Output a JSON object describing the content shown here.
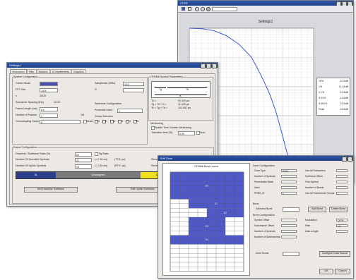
{
  "plot_window": {
    "title": "CCDF",
    "figure_title": "Settings1",
    "toolbar_icons": [
      "save-icon",
      "print-icon",
      "zoom-in-icon",
      "zoom-out-icon",
      "pan-icon"
    ],
    "zoom_field_value": "",
    "stats": [
      {
        "label": "10%",
        "value": "5.23dB"
      },
      {
        "label": "1%",
        "value": "11.61dB"
      },
      {
        "label": "0.1%",
        "value": "13.8dB"
      },
      {
        "label": "0.01%",
        "value": "14.8dB"
      },
      {
        "label": "0.001%",
        "value": "15.9dB"
      },
      {
        "label": "Peak",
        "value": "16.8dB"
      }
    ]
  },
  "chart_data": {
    "type": "line",
    "title": "Settings1",
    "xlabel": "",
    "ylabel": "",
    "xlim": [
      0,
      20
    ],
    "ylim": [
      1e-05,
      1
    ],
    "yscale": "log",
    "grid": true,
    "series": [
      {
        "x": [
          0,
          2,
          4,
          6,
          8,
          10,
          11,
          12,
          13,
          14,
          15,
          16,
          16.8
        ],
        "y": [
          1,
          0.96,
          0.82,
          0.55,
          0.28,
          0.1,
          0.04,
          0.015,
          0.005,
          0.0012,
          0.0002,
          3e-05,
          1e-05
        ]
      }
    ]
  },
  "settings_window": {
    "title": "Settings1",
    "tabs": [
      "Modulation",
      "Filter",
      "Markers",
      "IQ Impairments",
      "Graphics"
    ],
    "system_config": {
      "heading": "System Configuration",
      "carrier_mode_label": "Carrier Mode",
      "fft_size_label": "FFT Size",
      "fft_size_value": "1024",
      "samp_rate_label": "Samplerate (MHz)",
      "samp_rate_value": "10.0",
      "n_label": "n",
      "n_value": "28/25",
      "subcarrier_spacing_label": "Subcarrier Spacing (kHz)",
      "subcarrier_spacing_value": "10.94",
      "frame_length_label": "Frame Length (ms)",
      "frame_length_value": "5.0",
      "num_frames_label": "Number of Frames",
      "num_frames_value": "1",
      "oversampling_label": "Oversampling Factor",
      "oversampling_value": "8",
      "ratio_value": "1/8",
      "reduced_checkbox": "ldrate"
    },
    "subframe_config": {
      "heading": "Subframe Configuration",
      "preamble_label": "Preamble Index",
      "preamble_value": "0"
    },
    "group_selection": {
      "heading": "Group Selection",
      "items": [
        "0",
        "1",
        "2",
        "3",
        "4",
        "5"
      ]
    },
    "ofdma_params": {
      "heading": "OFDMA Symbol Parameters",
      "tg_label": "Tg",
      "tb_label": "Tb",
      "ts_label": "Ts",
      "tb_eq": "Tb =",
      "tb_val": "91.429 µs",
      "tg_eq": "Tg = Tb * G =",
      "tg_val": "11.429 µs",
      "ts_eq": "Ts = Tg + Tb =",
      "ts_val": "102.857 µs"
    },
    "windowing": {
      "heading": "Windowing",
      "enable_label": "Enable Time Domain Windowing",
      "transition_label": "Transition time (Ts)",
      "transition_value": "0.00",
      "auto_label": "Auto"
    },
    "frame_config": {
      "heading": "Frame Configuration",
      "dl_ratio_label": "Downlink / Subframe Ratio (%)",
      "dl_ratio_value": "50",
      "ttg_label": "Ttg Ratio",
      "dl_symbols_label": "Number Of Downlink Symbols",
      "dl_symbols_value": "21",
      "dl_symbols_calc": "(= 2.16 ms)",
      "dl_symbols_calc2": "(TTG: µs)",
      "ul_symbols_label": "Number Of Uplink Symbols",
      "ul_symbols_value": "18",
      "ul_symbols_calc": "(= 1.85 ms)",
      "ul_symbols_calc2": "(RTG: µs)",
      "remain_label": "Remain",
      "bar_labels": [
        "DL",
        "Unassigned",
        "UL"
      ],
      "edit_dl_button": "Edit Downlink Subframe",
      "edit_ul_button": "Edit Uplink Subframe"
    }
  },
  "edit_window": {
    "title": "Edit Zone",
    "grid_title": "OFDMA Burst Layout",
    "zone_config_heading": "Zone Configuration",
    "zone_fields": [
      "Zone Type",
      "Number of Symbols",
      "Permutation Base",
      "Uses",
      "PRBS_ID"
    ],
    "zone_values": [
      "PUSC",
      "",
      "",
      "",
      "0"
    ],
    "right_fields": [
      "Use All Subcarriers",
      "Subframe Offset",
      "First Symbol",
      "Number of Bursts",
      "Use All Subchannel Groups"
    ],
    "burst_heading": "Burst",
    "selected_burst_label": "Selected Burst",
    "add_burst_button": "Add Burst",
    "delete_burst_button": "Delete Burst",
    "burst_config_heading": "Burst Configuration",
    "burst_fields": [
      "Symbol Offset",
      "Subchannel Offset",
      "Number of Symbols",
      "Number of Subchannels"
    ],
    "burst_right_fields": [
      "Modulation",
      "Rate",
      "Data Length"
    ],
    "burst_right_values": [
      "QPSK",
      "1/2",
      ""
    ],
    "zone_boost_label": "Zone Boost",
    "configure_data_button": "Configure Data Source",
    "ok_button": "OK",
    "cancel_button": "Cancel",
    "burst_markers": [
      "B0",
      "B1",
      "B2",
      "B3",
      "B4"
    ]
  },
  "colors": {
    "accent": "#5059c8",
    "dl_bar": "#2d3f8a",
    "unassigned_bar": "#7a7a7a",
    "ul_bar": "#f0e020",
    "curve": "#2b4bd0"
  }
}
